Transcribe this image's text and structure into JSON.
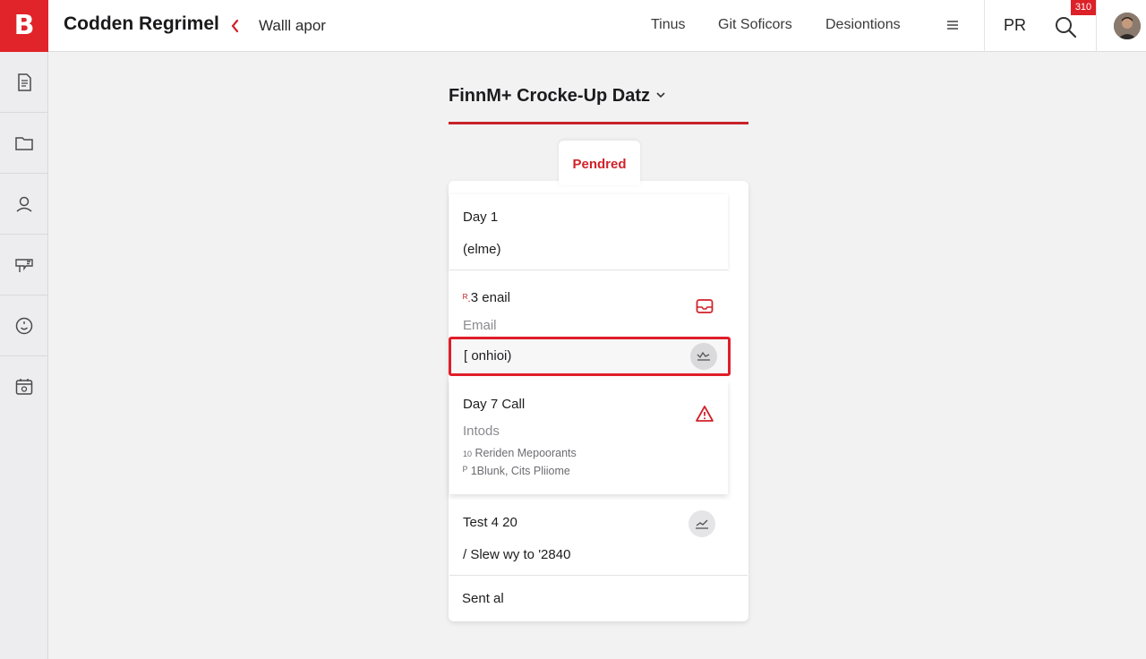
{
  "header": {
    "logo_letter": "B",
    "app_title": "Codden Regrimel",
    "breadcrumb": "Walll apor",
    "nav": [
      "Tinus",
      "Git Soficors",
      "Desiontions"
    ],
    "profile_label": "PR",
    "notification_count": "310",
    "accent_color": "#e0242a"
  },
  "sidebar": {
    "items": [
      {
        "icon": "document-icon"
      },
      {
        "icon": "folder-icon"
      },
      {
        "icon": "user-icon"
      },
      {
        "icon": "flag-icon"
      },
      {
        "icon": "smiley-icon"
      },
      {
        "icon": "calendar-icon"
      }
    ]
  },
  "main": {
    "title": "FinnM+ Crocke-Up Datz",
    "active_tab": "Pendred",
    "cards": [
      {
        "title": "Day 1",
        "subtitle": "(elme)"
      },
      {
        "title": "3 enail",
        "prefix": "ᴿ.",
        "subtitle": "Email",
        "icon": "mail-icon"
      },
      {
        "title": "Day 7 Call",
        "subtitle": "Intods",
        "detail_1": "Reriden Mepoorants",
        "detail_1_prefix": "10",
        "detail_2": "1Blunk, Cits Pliiome",
        "detail_2_prefix": "ᴾ",
        "icon": "warning-icon"
      },
      {
        "title": "Test 4 20",
        "subtitle": "/ Slew wy to '2840",
        "icon": "chart-icon"
      }
    ],
    "highlighted_row": {
      "label": "[ onhioi)",
      "icon": "signature-icon"
    },
    "footer": "Sent al"
  }
}
